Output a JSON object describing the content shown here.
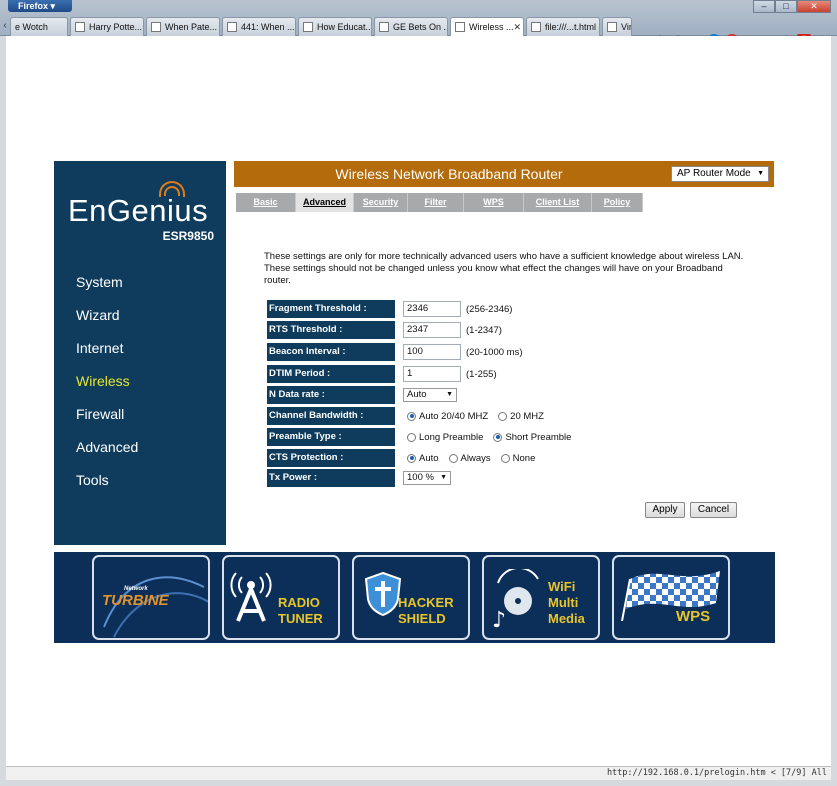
{
  "browser": {
    "app_button": "Firefox",
    "window_controls": [
      "–",
      "□",
      "✕"
    ],
    "tabs": [
      {
        "label": "e Wotch",
        "active": false
      },
      {
        "label": "Harry Potte...",
        "active": false
      },
      {
        "label": "When Pate...",
        "active": false
      },
      {
        "label": "441: When ...",
        "active": false
      },
      {
        "label": "How Educat...",
        "active": false
      },
      {
        "label": "GE Bets On ...",
        "active": false
      },
      {
        "label": "Wireless ...",
        "active": true
      },
      {
        "label": "file:///...t.html",
        "active": false
      },
      {
        "label": "Vir",
        "active": false
      }
    ],
    "status_url": "http://192.168.0.1/prelogin.htm < [7/9] All"
  },
  "router": {
    "brand": "EnGenius",
    "model": "ESR9850",
    "header_title": "Wireless Network Broadband Router",
    "mode_select": "AP Router Mode",
    "nav": [
      {
        "label": "System",
        "active": false
      },
      {
        "label": "Wizard",
        "active": false
      },
      {
        "label": "Internet",
        "active": false
      },
      {
        "label": "Wireless",
        "active": true
      },
      {
        "label": "Firewall",
        "active": false
      },
      {
        "label": "Advanced",
        "active": false
      },
      {
        "label": "Tools",
        "active": false
      }
    ],
    "subtabs": [
      {
        "label": "Basic",
        "active": false
      },
      {
        "label": "Advanced",
        "active": true
      },
      {
        "label": "Security",
        "active": false
      },
      {
        "label": "Filter",
        "active": false
      },
      {
        "label": "WPS",
        "active": false
      },
      {
        "label": "Client List",
        "active": false
      },
      {
        "label": "Policy",
        "active": false
      }
    ],
    "description": "These settings are only for more technically advanced users who have a sufficient knowledge about wireless LAN. These settings should not be changed unless you know what effect the changes will have on your Broadband router.",
    "settings": {
      "fragment": {
        "label": "Fragment Threshold :",
        "value": "2346",
        "hint": "(256-2346)"
      },
      "rts": {
        "label": "RTS Threshold :",
        "value": "2347",
        "hint": "(1-2347)"
      },
      "beacon": {
        "label": "Beacon Interval :",
        "value": "100",
        "hint": "(20-1000 ms)"
      },
      "dtim": {
        "label": "DTIM Period :",
        "value": "1",
        "hint": "(1-255)"
      },
      "ndata": {
        "label": "N Data rate :",
        "value": "Auto"
      },
      "bandwidth": {
        "label": "Channel Bandwidth :",
        "options": [
          "Auto 20/40 MHZ",
          "20 MHZ"
        ],
        "selected": 0
      },
      "preamble": {
        "label": "Preamble Type :",
        "options": [
          "Long Preamble",
          "Short Preamble"
        ],
        "selected": 1
      },
      "cts": {
        "label": "CTS Protection :",
        "options": [
          "Auto",
          "Always",
          "None"
        ],
        "selected": 0
      },
      "txpower": {
        "label": "Tx Power :",
        "value": "100 %"
      }
    },
    "apply_label": "Apply",
    "cancel_label": "Cancel",
    "banner": {
      "turbine_small": "Network",
      "turbine": "TURBINE",
      "radio": "RADIO",
      "tuner": "TUNER",
      "hacker": "HACKER",
      "shield": "SHIELD",
      "wifi": "WiFi",
      "multi": "Multi",
      "media": "Media",
      "wps": "WPS"
    }
  },
  "colors": {
    "nav_bg": "#0f3c5c",
    "header_bg": "#b46b0c",
    "active_nav": "#e7e82d",
    "banner_bg": "#0c2f5a"
  }
}
